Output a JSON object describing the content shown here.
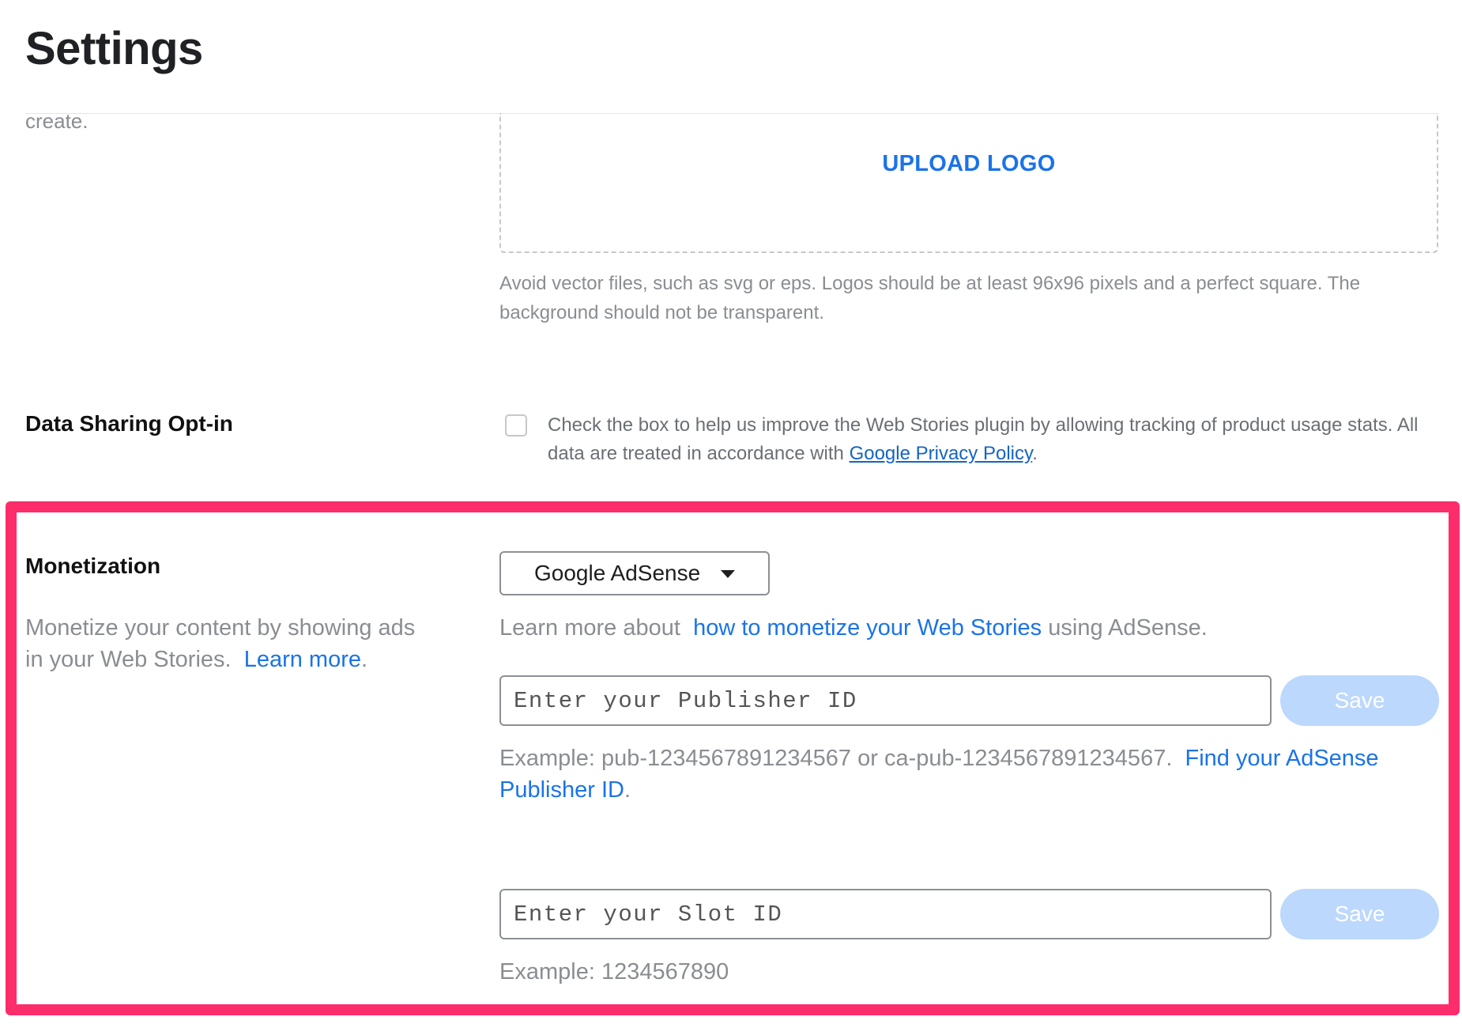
{
  "page": {
    "title": "Settings"
  },
  "logo_section": {
    "cut_off_text": "create.",
    "upload_button_label": "UPLOAD LOGO",
    "help_text": "Avoid vector files, such as svg or eps. Logos should be at least 96x96 pixels and a perfect square. The background should not be transparent."
  },
  "data_sharing": {
    "label": "Data Sharing Opt-in",
    "checked": false,
    "text_before_link": "Check the box to help us improve the Web Stories plugin by allowing tracking of product usage stats. All data are treated in accordance with ",
    "link_label": "Google Privacy Policy",
    "text_after_link": "."
  },
  "monetization": {
    "highlight_color": "#fd2d6b",
    "label": "Monetization",
    "description": "Monetize your content by showing ads in your Web Stories.",
    "description_link": "Learn more",
    "description_after": ".",
    "provider_selected": "Google AdSense",
    "learn_more_prefix": "Learn more about",
    "learn_more_link": "how to monetize your Web Stories",
    "learn_more_suffix": " using AdSense.",
    "publisher_id": {
      "value": "",
      "placeholder": "Enter your Publisher ID",
      "save_label": "Save",
      "example_text": "Example: pub-1234567891234567 or ca-pub-1234567891234567.",
      "example_link": "Find your AdSense Publisher ID",
      "example_after": "."
    },
    "slot_id": {
      "value": "",
      "placeholder": "Enter your Slot ID",
      "save_label": "Save",
      "example_text": "Example: 1234567890"
    }
  },
  "colors": {
    "link": "#1a73e8",
    "save_disabled": "#bcd8fc"
  }
}
